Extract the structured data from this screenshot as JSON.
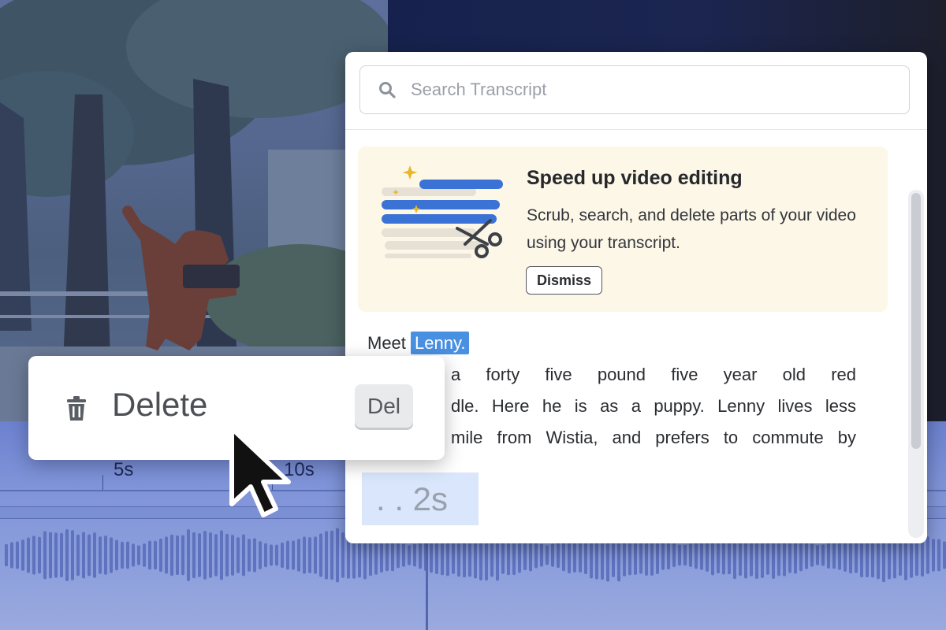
{
  "search": {
    "placeholder": "Search Transcript"
  },
  "promo": {
    "title": "Speed up video editing",
    "body": "Scrub, search, and delete parts of your video using your transcript.",
    "dismiss_label": "Dismiss"
  },
  "transcript": {
    "line1_prefix": "Meet",
    "line1_highlight": "Lenny.",
    "line2": "a forty five pound five year old red",
    "line3": "dle. Here he is as a puppy. Lenny lives less",
    "line4": "mile from Wistia, and prefers to commute by"
  },
  "pause_chip": ". . 2s",
  "context_menu": {
    "label": "Delete",
    "shortcut": "Del",
    "icon": "trash-icon"
  },
  "timeline": {
    "tick_labels": [
      "5s",
      "10s"
    ]
  },
  "colors": {
    "highlight": "#4a90e2",
    "promo_background": "#fdf7e8",
    "pause_chip": "#d9e6fb"
  }
}
